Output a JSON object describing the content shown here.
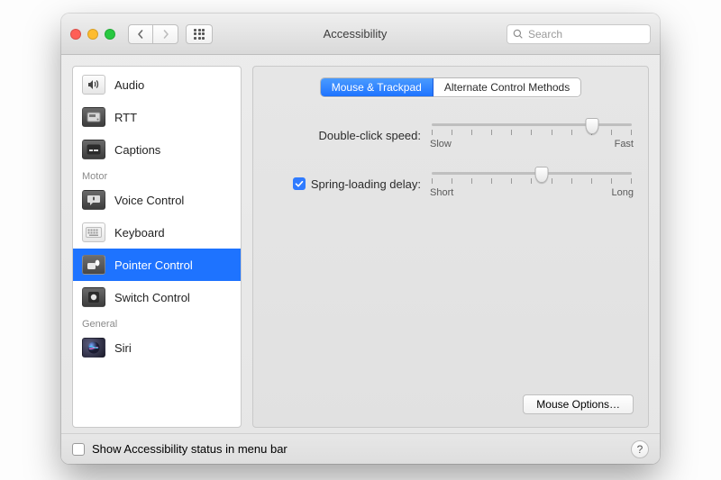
{
  "window": {
    "title": "Accessibility"
  },
  "search": {
    "placeholder": "Search"
  },
  "sidebar": {
    "items": [
      {
        "label": "Audio"
      },
      {
        "label": "RTT"
      },
      {
        "label": "Captions"
      }
    ],
    "motor_header": "Motor",
    "motor_items": [
      {
        "label": "Voice Control"
      },
      {
        "label": "Keyboard"
      },
      {
        "label": "Pointer Control"
      },
      {
        "label": "Switch Control"
      }
    ],
    "general_header": "General",
    "general_items": [
      {
        "label": "Siri"
      }
    ]
  },
  "tabs": {
    "mouse_trackpad": "Mouse & Trackpad",
    "alternate": "Alternate Control Methods"
  },
  "controls": {
    "double_click_label": "Double-click speed:",
    "double_click_min": "Slow",
    "double_click_max": "Fast",
    "double_click_value_pct": 80,
    "spring_label": "Spring-loading delay:",
    "spring_checked": true,
    "spring_min": "Short",
    "spring_max": "Long",
    "spring_value_pct": 55,
    "mouse_options": "Mouse Options…"
  },
  "footer": {
    "show_status_label": "Show Accessibility status in menu bar",
    "show_status_checked": false,
    "help": "?"
  }
}
